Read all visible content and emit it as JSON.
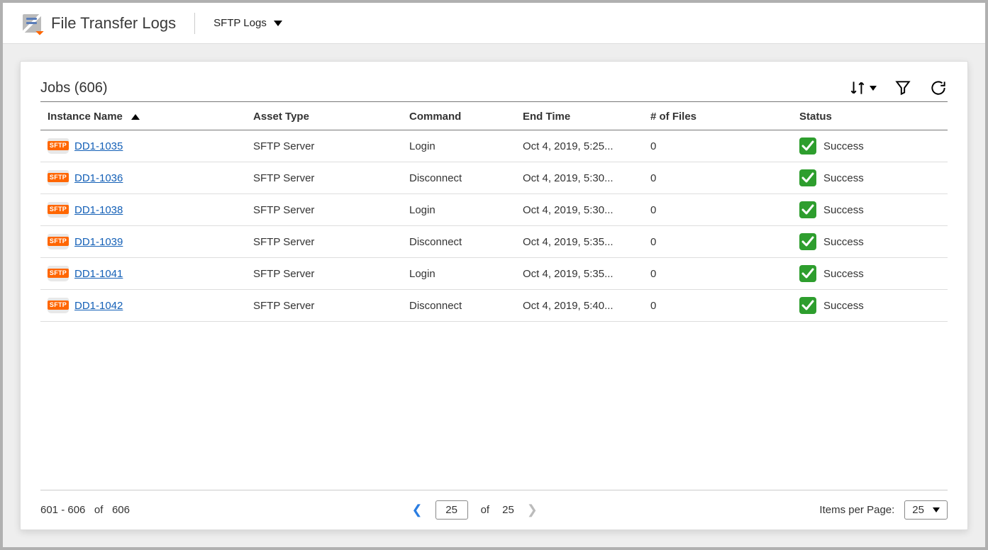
{
  "header": {
    "page_title": "File Transfer Logs",
    "log_type": "SFTP Logs"
  },
  "panel": {
    "jobs_label": "Jobs",
    "jobs_count": 606
  },
  "columns": {
    "instance": "Instance Name",
    "asset": "Asset Type",
    "command": "Command",
    "end_time": "End Time",
    "files": "# of Files",
    "status": "Status"
  },
  "rows": [
    {
      "instance": "DD1-1035",
      "asset": "SFTP Server",
      "command": "Login",
      "end": "Oct 4, 2019, 5:25...",
      "files": "0",
      "status": "Success"
    },
    {
      "instance": "DD1-1036",
      "asset": "SFTP Server",
      "command": "Disconnect",
      "end": "Oct 4, 2019, 5:30...",
      "files": "0",
      "status": "Success"
    },
    {
      "instance": "DD1-1038",
      "asset": "SFTP Server",
      "command": "Login",
      "end": "Oct 4, 2019, 5:30...",
      "files": "0",
      "status": "Success"
    },
    {
      "instance": "DD1-1039",
      "asset": "SFTP Server",
      "command": "Disconnect",
      "end": "Oct 4, 2019, 5:35...",
      "files": "0",
      "status": "Success"
    },
    {
      "instance": "DD1-1041",
      "asset": "SFTP Server",
      "command": "Login",
      "end": "Oct 4, 2019, 5:35...",
      "files": "0",
      "status": "Success"
    },
    {
      "instance": "DD1-1042",
      "asset": "SFTP Server",
      "command": "Disconnect",
      "end": "Oct 4, 2019, 5:40...",
      "files": "0",
      "status": "Success"
    }
  ],
  "pager": {
    "range_from": "601",
    "range_to": "606",
    "range_of": "of",
    "total": "606",
    "current_page": "25",
    "page_of": "of",
    "page_total": "25",
    "items_label": "Items per Page:",
    "items_value": "25"
  }
}
